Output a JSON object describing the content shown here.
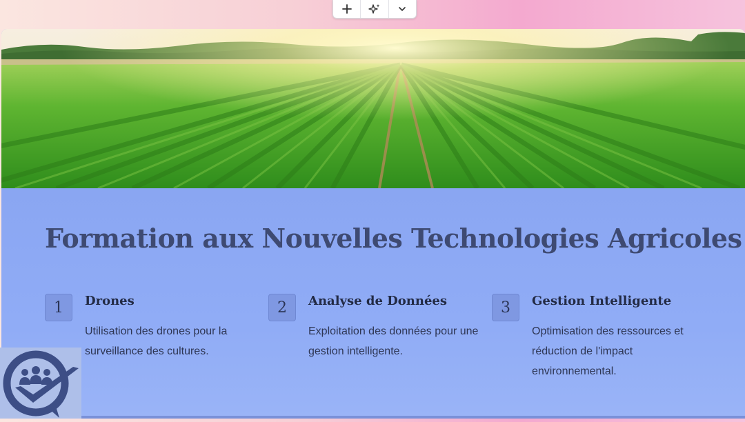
{
  "toolbar": {
    "buttons": [
      {
        "icon": "plus-icon"
      },
      {
        "icon": "sparkle-icon"
      },
      {
        "icon": "chevron-down-icon"
      }
    ]
  },
  "slide": {
    "hero_image": "crop-field-sunrise",
    "title": "Formation aux Nouvelles Technologies Agricoles",
    "features": [
      {
        "number": "1",
        "title": "Drones",
        "description": "Utilisation des drones pour la surveillance des cultures."
      },
      {
        "number": "2",
        "title": "Analyse de Données",
        "description": "Exploitation des données pour une gestion intelligente."
      },
      {
        "number": "3",
        "title": "Gestion Intelligente",
        "description": "Optimisation des ressources et réduction de l'impact environnemental."
      }
    ]
  },
  "colors": {
    "content_background": "#8fa9f3",
    "title": "#3e4a72",
    "number_box": "#7f98e2",
    "logo_dark": "#3d4e86"
  }
}
